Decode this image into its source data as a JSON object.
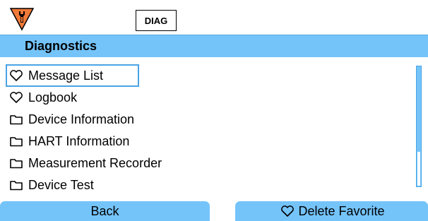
{
  "status": {
    "warning_icon": "wrench-warning-icon",
    "warning_color": "#f07a3a",
    "mode_label": "DIAG"
  },
  "header": {
    "title": "Diagnostics",
    "bar_color": "#74c4fa"
  },
  "menu": {
    "items": [
      {
        "label": "Message List",
        "icon": "favorite-heart-icon",
        "selected": true
      },
      {
        "label": "Logbook",
        "icon": "favorite-heart-icon",
        "selected": false
      },
      {
        "label": "Device Information",
        "icon": "folder-icon",
        "selected": false
      },
      {
        "label": "HART Information",
        "icon": "folder-icon",
        "selected": false
      },
      {
        "label": "Measurement Recorder",
        "icon": "folder-icon",
        "selected": false
      },
      {
        "label": "Device Test",
        "icon": "folder-icon",
        "selected": false
      }
    ]
  },
  "softkeys": {
    "left_label": "Back",
    "right_label": "Delete Favorite",
    "right_icon": "favorite-heart-icon"
  }
}
